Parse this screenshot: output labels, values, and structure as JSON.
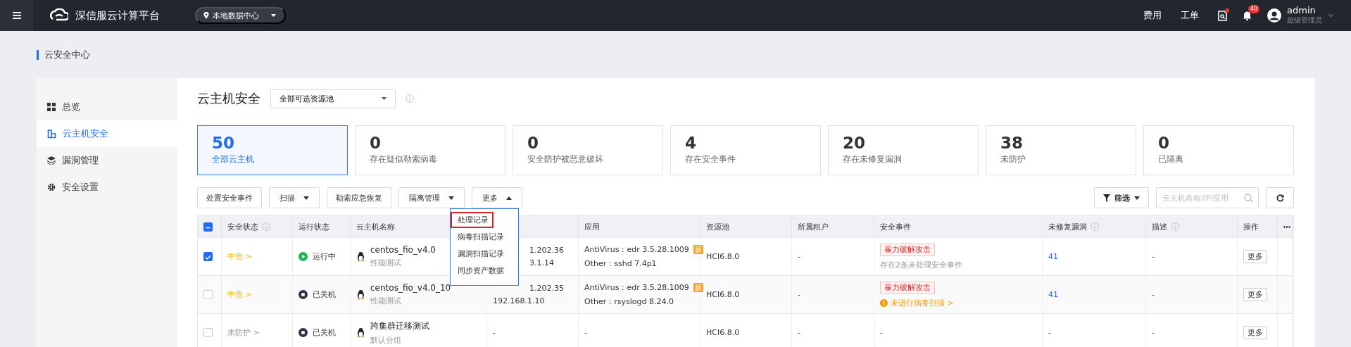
{
  "topbar": {
    "brand": "深信服云计算平台",
    "datacenter": "本地数据中心",
    "links": [
      "费用",
      "工单"
    ],
    "notification_count": "40",
    "user": {
      "name": "admin",
      "role": "超级管理员"
    }
  },
  "breadcrumb": "云安全中心",
  "sidebar": {
    "items": [
      {
        "label": "总览",
        "selected": false
      },
      {
        "label": "云主机安全",
        "selected": true
      },
      {
        "label": "漏洞管理",
        "selected": false
      },
      {
        "label": "安全设置",
        "selected": false
      }
    ]
  },
  "page": {
    "title": "云主机安全",
    "pool_select": "全部可选资源池"
  },
  "stats": [
    {
      "value": "50",
      "label": "全部云主机",
      "selected": true
    },
    {
      "value": "0",
      "label": "存在疑似勒索病毒",
      "selected": false
    },
    {
      "value": "0",
      "label": "安全防护被恶意破坏",
      "selected": false
    },
    {
      "value": "4",
      "label": "存在安全事件",
      "selected": false
    },
    {
      "value": "20",
      "label": "存在未修复漏洞",
      "selected": false
    },
    {
      "value": "38",
      "label": "未防护",
      "selected": false
    },
    {
      "value": "0",
      "label": "已隔离",
      "selected": false
    }
  ],
  "toolbar": {
    "buttons": [
      {
        "label": "处置安全事件",
        "kind": "plain"
      },
      {
        "label": "扫描",
        "kind": "menu",
        "expanded": false
      },
      {
        "label": "勒索应急恢复",
        "kind": "plain"
      },
      {
        "label": "隔离管理",
        "kind": "menu",
        "expanded": false
      },
      {
        "label": "更多",
        "kind": "menu",
        "expanded": true
      }
    ],
    "filter": "筛选",
    "search": {
      "placeholder": "云主机名称/IP/应用"
    }
  },
  "more_menu": {
    "items": [
      {
        "label": "处理记录",
        "selected": true
      },
      {
        "label": "病毒扫描记录",
        "selected": false
      },
      {
        "label": "漏洞扫描记录",
        "selected": false
      },
      {
        "label": "同步资产数据",
        "selected": false
      }
    ]
  },
  "table": {
    "header_checkbox": {
      "indeterminate": true
    },
    "columns": [
      {
        "label": "安全状态",
        "info": true
      },
      {
        "label": "运行状态",
        "info": false
      },
      {
        "label": "云主机名称",
        "info": false
      },
      {
        "label": "应用",
        "info": false
      },
      {
        "label": "资源池",
        "info": false
      },
      {
        "label": "所属租户",
        "info": false
      },
      {
        "label": "安全事件",
        "info": false
      },
      {
        "label": "未修复漏洞",
        "info": true
      },
      {
        "label": "描述",
        "info": true
      },
      {
        "label": "操作",
        "info": false
      }
    ],
    "rows": [
      {
        "selected": true,
        "risk": {
          "text": "中危 >",
          "kind": "medium"
        },
        "run_state": "运行中",
        "running": true,
        "name": "centos_fio_v4.0",
        "group": "性能测试",
        "ip": [
          {
            "text": "1.202.36",
            "clipped": true
          },
          {
            "text": "3.1.14",
            "clipped": true
          }
        ],
        "apps": [
          {
            "text": "AntiVirus：edr 3.5.28.1009",
            "badge": "新"
          },
          {
            "text": "Other：sshd 7.4p1"
          }
        ],
        "pool": "HCI6.8.0",
        "tenant": "-",
        "event": {
          "tag": "暴力破解攻击",
          "note": "存在2条未处理安全事件",
          "kind": "info"
        },
        "vulns": "41",
        "vulns_link": true,
        "desc": "-",
        "action": "更多"
      },
      {
        "selected": false,
        "risk": {
          "text": "中危 >",
          "kind": "medium"
        },
        "run_state": "已关机",
        "running": false,
        "name": "centos_fio_v4.0_10",
        "group": "性能测试",
        "ip": [
          {
            "text": "1.202.35",
            "clipped": true
          },
          {
            "text": "192.168.1.10",
            "clipped": false
          }
        ],
        "apps": [
          {
            "text": "AntiVirus：edr 3.5.28.1009",
            "badge": "新"
          },
          {
            "text": "Other：rsyslogd 8.24.0"
          }
        ],
        "pool": "HCI6.8.0",
        "tenant": "-",
        "event": {
          "tag": "暴力破解攻击",
          "note": "未进行病毒扫描 >",
          "kind": "warning"
        },
        "vulns": "41",
        "vulns_link": true,
        "desc": "-",
        "action": "更多"
      },
      {
        "selected": false,
        "risk": {
          "text": "未防护 >",
          "kind": "unprotected"
        },
        "run_state": "已关机",
        "running": false,
        "name": "跨集群迁移测试",
        "group": "默认分组",
        "ip": [
          {
            "text": "-",
            "clipped": false
          }
        ],
        "apps": [
          {
            "text": "-"
          }
        ],
        "pool": "HCI6.8.0",
        "tenant": "-",
        "event": {
          "text": "-"
        },
        "vulns": "-",
        "vulns_link": false,
        "desc": "-",
        "action": "更多"
      }
    ]
  }
}
